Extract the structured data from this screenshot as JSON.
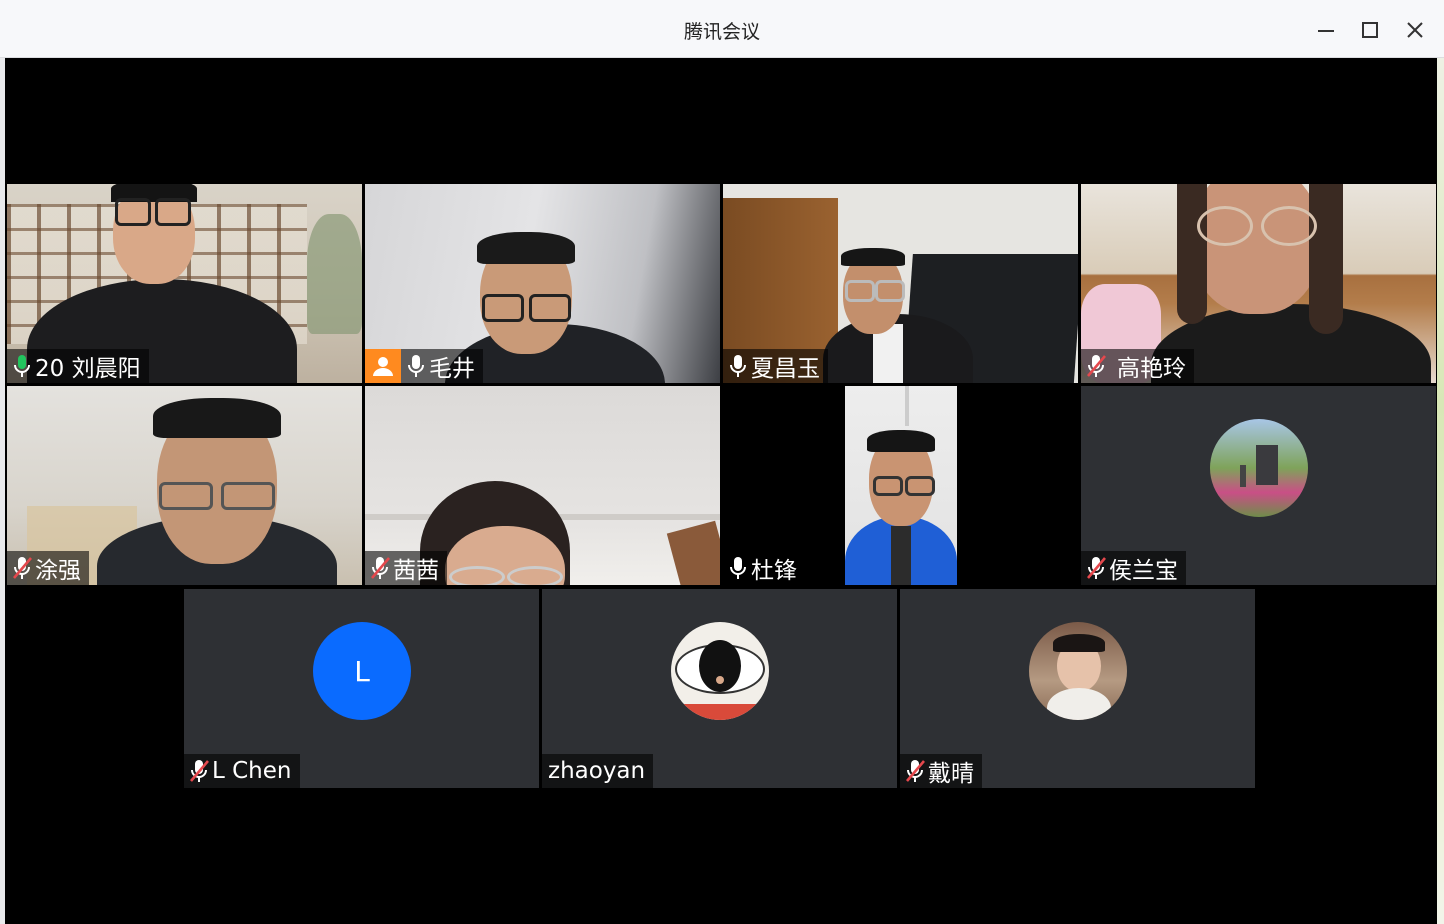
{
  "window": {
    "title": "腾讯会议",
    "controls": {
      "minimize": "minimize",
      "maximize": "maximize",
      "close": "close"
    }
  },
  "participants": {
    "p1": {
      "name": "20 刘晨阳",
      "mic": "on-active"
    },
    "p2": {
      "name": "毛井",
      "mic": "on",
      "host": true
    },
    "p3": {
      "name": "夏昌玉",
      "mic": "on"
    },
    "p4": {
      "name": "高艳玲",
      "mic": "muted"
    },
    "p5": {
      "name": "涂强",
      "mic": "muted"
    },
    "p6": {
      "name": "茜茜",
      "mic": "muted"
    },
    "p7": {
      "name": "杜锋",
      "mic": "on"
    },
    "p8": {
      "name": "侯兰宝",
      "mic": "muted",
      "avatar": "photo"
    },
    "p9": {
      "name": "L Chen",
      "mic": "muted",
      "avatar_letter": "L"
    },
    "p10": {
      "name": "zhaoyan",
      "mic": "none",
      "avatar": "eye-illustration"
    },
    "p11": {
      "name": "戴晴",
      "mic": "muted",
      "avatar": "photo"
    }
  },
  "colors": {
    "tile_bg": "#2e3034",
    "host_badge": "#ff8a1f",
    "letter_avatar": "#0a6bff",
    "mic_active": "#22c55e",
    "mic_muted": "#e5484d"
  }
}
